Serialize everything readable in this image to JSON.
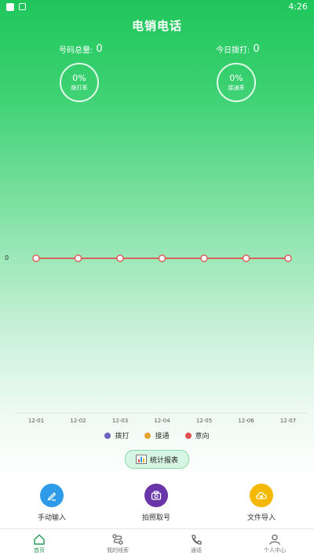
{
  "status_bar": {
    "time": "4:26"
  },
  "header": {
    "title": "电销电话"
  },
  "stats": {
    "total_label": "号码总量:",
    "total_value": "0",
    "today_label": "今日拨打:",
    "today_value": "0",
    "dial_rate": {
      "value": "0%",
      "label": "拨打率"
    },
    "connect_rate": {
      "value": "0%",
      "label": "接通率"
    }
  },
  "chart_data": {
    "type": "line",
    "categories": [
      "12-01",
      "12-02",
      "12-03",
      "12-04",
      "12-05",
      "12-06",
      "12-07"
    ],
    "yticks": [
      "0"
    ],
    "series": [
      {
        "name": "拨打",
        "color": "#6a62c3",
        "values": [
          0,
          0,
          0,
          0,
          0,
          0,
          0
        ]
      },
      {
        "name": "接通",
        "color": "#e6a030",
        "values": [
          0,
          0,
          0,
          0,
          0,
          0,
          0
        ]
      },
      {
        "name": "意向",
        "color": "#e05050",
        "values": [
          0,
          0,
          0,
          0,
          0,
          0,
          0
        ]
      }
    ]
  },
  "report_button": {
    "label": "统计报表",
    "icon": "bar-chart-icon"
  },
  "actions": [
    {
      "label": "手动输入",
      "icon": "pencil-icon",
      "color": "#2d9be8"
    },
    {
      "label": "拍照取号",
      "icon": "camera-icon",
      "color": "#6a35a8"
    },
    {
      "label": "文件导入",
      "icon": "cloud-upload-icon",
      "color": "#f5b800"
    }
  ],
  "tabs": [
    {
      "label": "首页",
      "icon": "home-icon",
      "active": true
    },
    {
      "label": "我的线索",
      "icon": "route-icon",
      "active": false
    },
    {
      "label": "通话",
      "icon": "phone-icon",
      "active": false
    },
    {
      "label": "个人中心",
      "icon": "user-icon",
      "active": false
    }
  ]
}
